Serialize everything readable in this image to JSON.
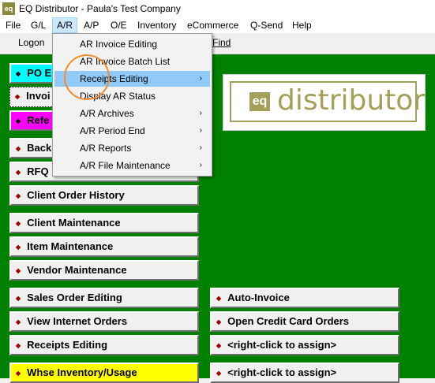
{
  "window": {
    "title": "EQ Distributor - Paula's Test Company",
    "icon_text": "eq"
  },
  "menubar": [
    "File",
    "G/L",
    "A/R",
    "A/P",
    "O/E",
    "Inventory",
    "eCommerce",
    "Q-Send",
    "Help"
  ],
  "toolbar": {
    "logon": "Logon",
    "find": "Find"
  },
  "dropdown": {
    "items": [
      {
        "label": "AR Invoice Editing",
        "submenu": false
      },
      {
        "label": "AR Invoice Batch List",
        "submenu": false
      },
      {
        "label": "Receipts Editing",
        "submenu": true,
        "highlighted": true
      },
      {
        "label": "Display AR Status",
        "submenu": false
      },
      {
        "label": "A/R Archives",
        "submenu": true
      },
      {
        "label": "A/R Period End",
        "submenu": true
      },
      {
        "label": "A/R Reports",
        "submenu": true
      },
      {
        "label": "A/R File Maintenance",
        "submenu": true
      }
    ],
    "submenu_arrow": "›"
  },
  "left_buttons": [
    {
      "label": "PO E"
    },
    {
      "label": "Invoi"
    },
    {
      "label": "Refe"
    },
    {
      "label": "Back"
    },
    {
      "label": "RFQ"
    },
    {
      "label": "Client Order History"
    },
    {
      "label": "Client Maintenance"
    },
    {
      "label": "Item Maintenance"
    },
    {
      "label": "Vendor Maintenance"
    },
    {
      "label": "Sales Order Editing"
    },
    {
      "label": "View Internet Orders"
    },
    {
      "label": "Receipts Editing"
    },
    {
      "label": "Whse Inventory/Usage"
    }
  ],
  "right_buttons": [
    {
      "label": "Auto-Invoice"
    },
    {
      "label": "Open Credit Card Orders"
    },
    {
      "label": "<right-click to assign>"
    },
    {
      "label": "<right-click to assign>"
    }
  ],
  "logo": {
    "mark": "eq",
    "text": "distributor"
  },
  "colors": {
    "background_green": "#008000",
    "cyan": "#00ffff",
    "magenta": "#ff00ff",
    "yellow": "#ffff00",
    "logo_olive": "#a4a05a",
    "highlight": "#91c9f7",
    "annotation_circle": "#f28a2e"
  },
  "bullet_glyph": "◆"
}
